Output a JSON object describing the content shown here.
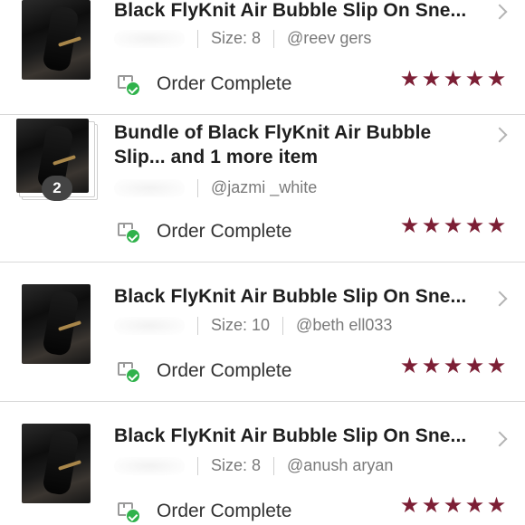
{
  "colors": {
    "star": "#7c1f35",
    "check": "#2fb24b",
    "divider": "#d8d8d8"
  },
  "icons": {
    "chevron": "chevron-right-icon",
    "status": "package-check-icon",
    "rating": "star-icon"
  },
  "orders": [
    {
      "title": "Black FlyKnit Air Bubble Slip On Sne...",
      "size": "Size: 8",
      "buyer": "@reev    gers",
      "status": "Order Complete",
      "rating": 5
    },
    {
      "title_line1": "Bundle of Black FlyKnit Air Bubble",
      "title_line2": "Slip... and 1 more item",
      "buyer": "@jazmi     _white",
      "bundle_count": "2",
      "status": "Order Complete",
      "rating": 5
    },
    {
      "title": "Black FlyKnit Air Bubble Slip On Sne...",
      "size": "Size: 10",
      "buyer": "@beth      ell033",
      "status": "Order Complete",
      "rating": 5
    },
    {
      "title": "Black FlyKnit Air Bubble Slip On Sne...",
      "size": "Size: 8",
      "buyer": "@anush      aryan",
      "status": "Order Complete",
      "rating": 5
    }
  ]
}
